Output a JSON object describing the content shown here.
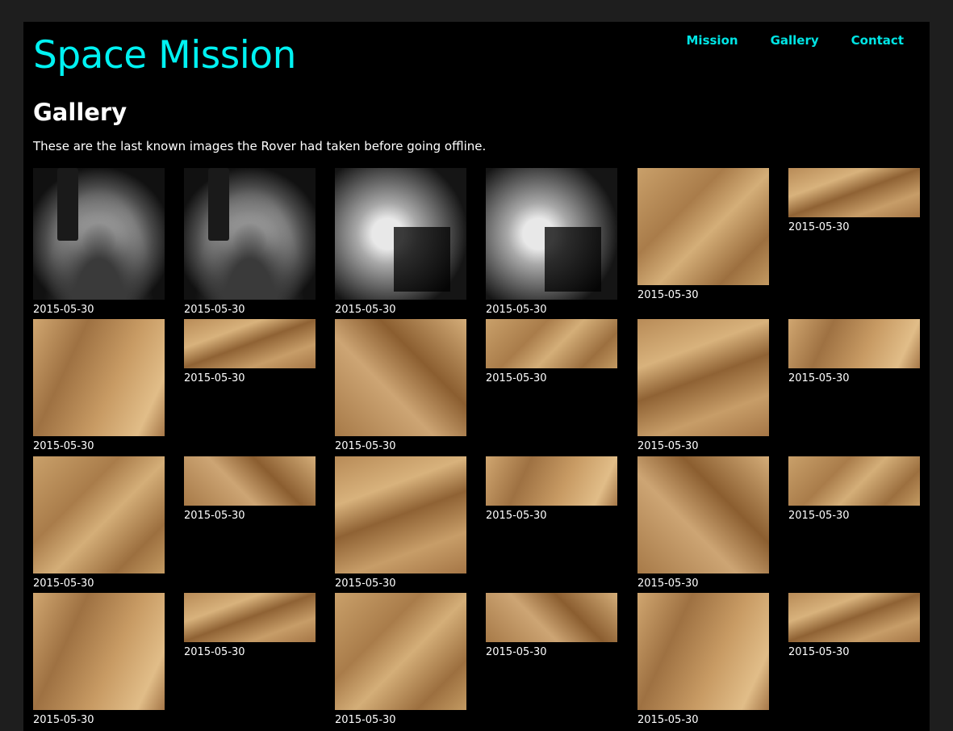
{
  "site": {
    "title": "Space Mission"
  },
  "nav": {
    "items": [
      {
        "label": "Mission"
      },
      {
        "label": "Gallery"
      },
      {
        "label": "Contact"
      }
    ]
  },
  "main": {
    "heading": "Gallery",
    "intro": "These are the last known images the Rover had taken before going offline."
  },
  "gallery": {
    "images": [
      {
        "date": "2015-05-30"
      },
      {
        "date": "2015-05-30"
      },
      {
        "date": "2015-05-30"
      },
      {
        "date": "2015-05-30"
      },
      {
        "date": "2015-05-30"
      },
      {
        "date": "2015-05-30"
      },
      {
        "date": "2015-05-30"
      },
      {
        "date": "2015-05-30"
      },
      {
        "date": "2015-05-30"
      },
      {
        "date": "2015-05-30"
      },
      {
        "date": "2015-05-30"
      },
      {
        "date": "2015-05-30"
      },
      {
        "date": "2015-05-30"
      },
      {
        "date": "2015-05-30"
      },
      {
        "date": "2015-05-30"
      },
      {
        "date": "2015-05-30"
      },
      {
        "date": "2015-05-30"
      },
      {
        "date": "2015-05-30"
      },
      {
        "date": "2015-05-30"
      },
      {
        "date": "2015-05-30"
      },
      {
        "date": "2015-05-30"
      },
      {
        "date": "2015-05-30"
      },
      {
        "date": "2015-05-30"
      },
      {
        "date": "2015-05-30"
      }
    ]
  }
}
